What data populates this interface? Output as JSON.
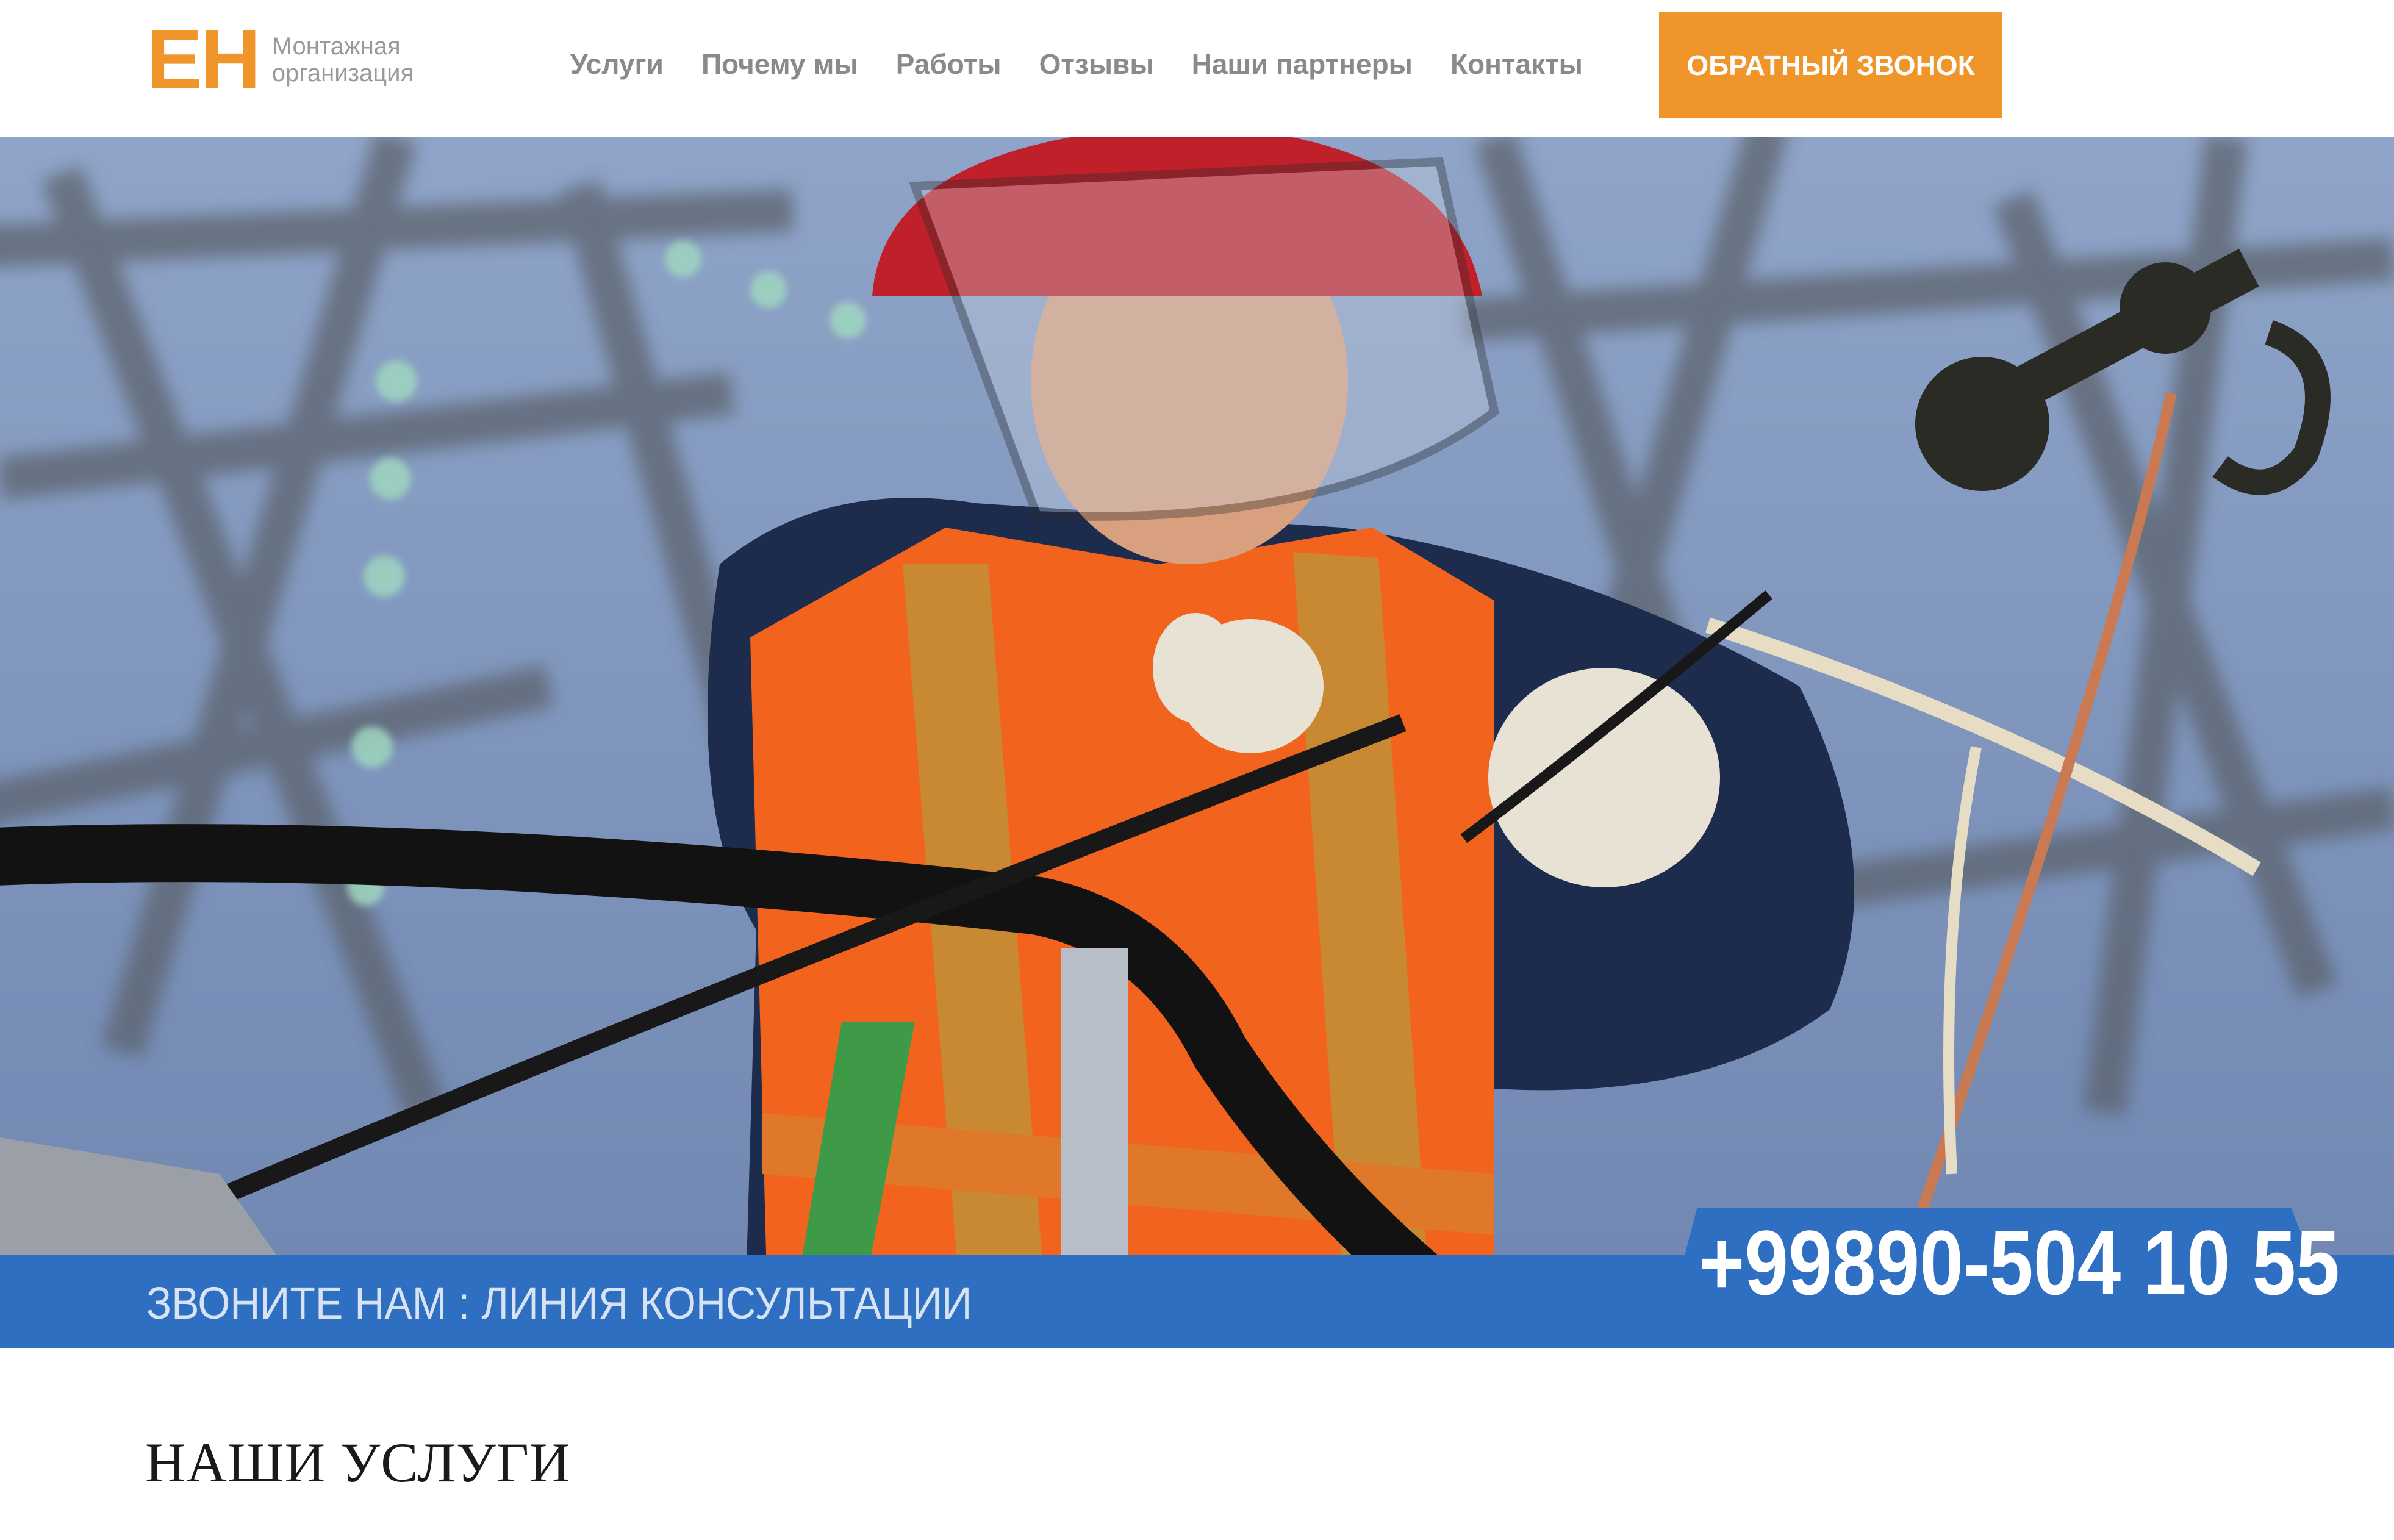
{
  "header": {
    "logo": {
      "mark": "EH",
      "line1": "Монтажная",
      "line2": "организация"
    },
    "nav": [
      {
        "label": "Услуги"
      },
      {
        "label": "Почему мы"
      },
      {
        "label": "Работы"
      },
      {
        "label": "Отзывы"
      },
      {
        "label": "Наши партнеры"
      },
      {
        "label": "Контакты"
      }
    ],
    "callback_button": "ОБРАТНЫЙ ЗВОНОК"
  },
  "hero": {
    "image": "electrician-worker-on-power-line"
  },
  "consult": {
    "text": "ЗВОНИТЕ НАМ : ЛИНИЯ КОНСУЛЬТАЦИИ",
    "phone": "+99890-504 10 55"
  },
  "services": {
    "title": "НАШИ УСЛУГИ"
  },
  "colors": {
    "accent_orange": "#f0952a",
    "accent_blue": "#2f6fc2",
    "nav_text": "#8a8a8a"
  }
}
